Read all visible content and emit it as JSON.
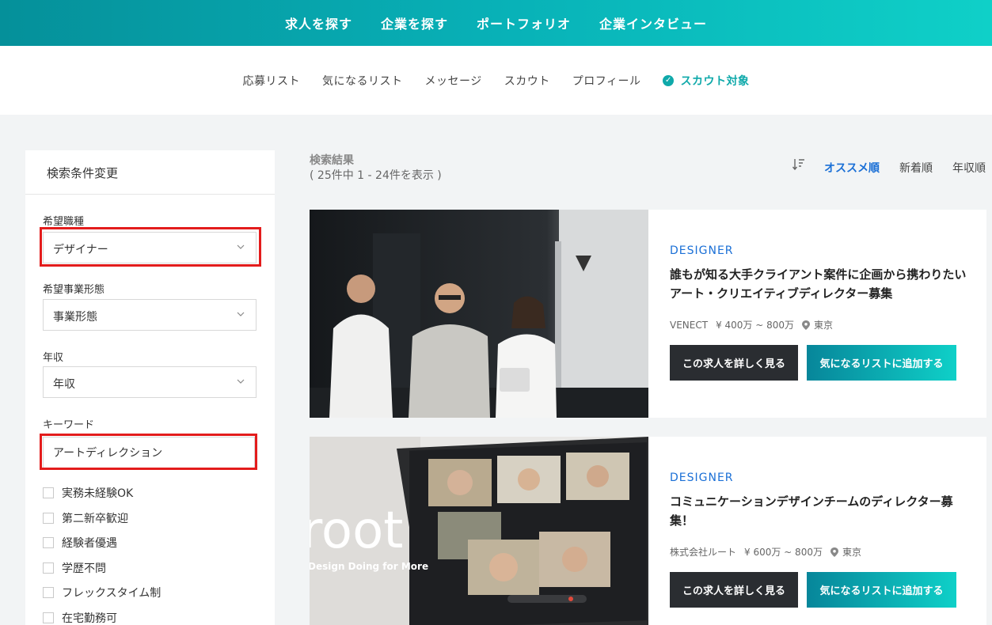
{
  "topnav": {
    "items": [
      "求人を探す",
      "企業を探す",
      "ポートフォリオ",
      "企業インタビュー"
    ]
  },
  "subnav": {
    "items": [
      "応募リスト",
      "気になるリスト",
      "メッセージ",
      "スカウト",
      "プロフィール"
    ],
    "scout_target": "スカウト対象"
  },
  "sidebar": {
    "title": "検索条件変更",
    "job_type": {
      "label": "希望職種",
      "value": "デザイナー"
    },
    "business_type": {
      "label": "希望事業形態",
      "value": "事業形態"
    },
    "salary": {
      "label": "年収",
      "value": "年収"
    },
    "keyword": {
      "label": "キーワード",
      "value": "アートディレクション"
    },
    "checkboxes": [
      "実務未経験OK",
      "第二新卒歓迎",
      "経験者優遇",
      "学歴不問",
      "フレックスタイム制",
      "在宅勤務可"
    ]
  },
  "results": {
    "title": "検索結果",
    "count": "( 25件中 1 - 24件を表示 )",
    "sort": [
      "オススメ順",
      "新着順",
      "年収順"
    ]
  },
  "cards": [
    {
      "category": "DESIGNER",
      "title": "誰もが知る大手クライアント案件に企画から携わりたいアート・クリエイティブディレクター募集",
      "company": "VENECT",
      "salary": "¥ 400万 ~ 800万",
      "location": "東京",
      "detail_label": "この求人を詳しく見る",
      "fav_label": "気になるリストに追加する"
    },
    {
      "category": "DESIGNER",
      "title": "コミュニケーションデザインチームのディレクター募集！",
      "company": "株式会社ルート",
      "salary": "¥ 600万 ~ 800万",
      "location": "東京",
      "detail_label": "この求人を詳しく見る",
      "fav_label": "気になるリストに追加する",
      "photo_text": "root",
      "photo_tagline": "Design Doing for More"
    }
  ],
  "colors": {
    "accent": "#0fa9aa",
    "highlight": "#e31c1c",
    "link_blue": "#1a6fd6",
    "dark_button": "#2a2d31"
  }
}
